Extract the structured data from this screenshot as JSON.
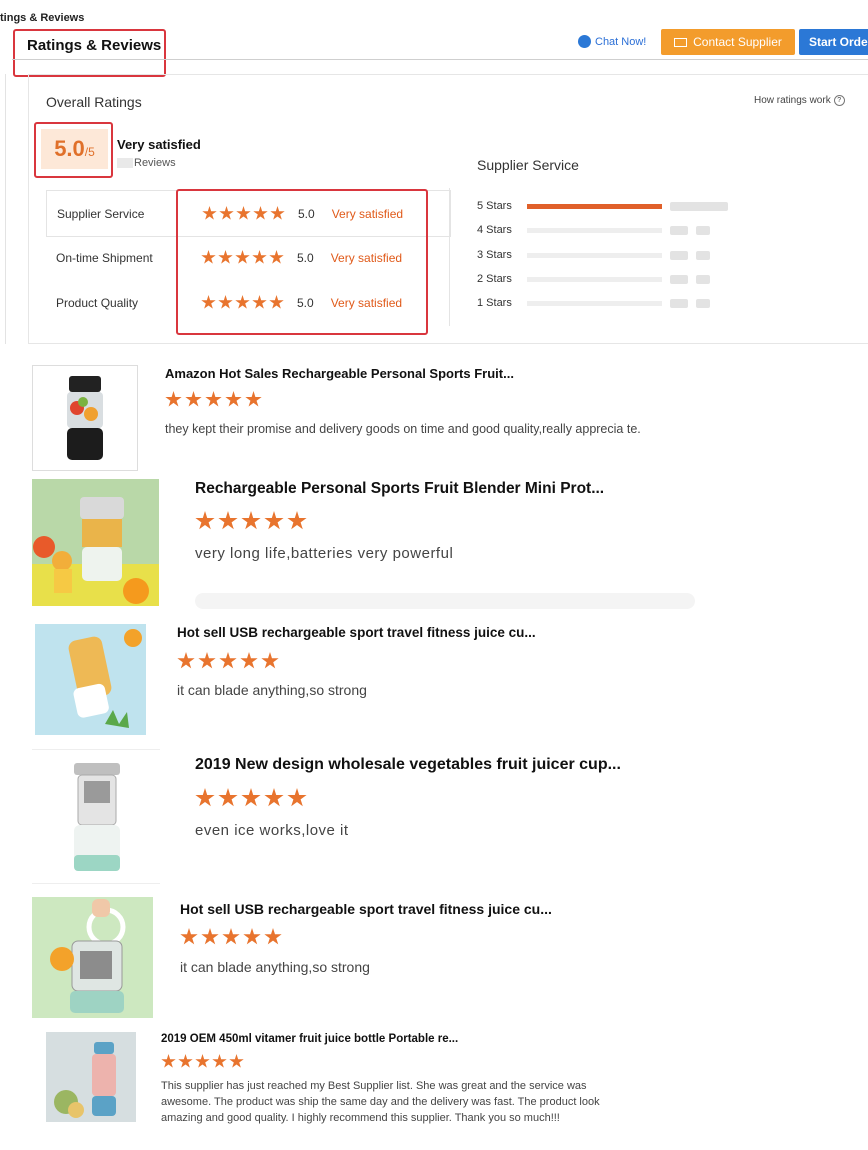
{
  "breadcrumb": "tings & Reviews",
  "tab": {
    "title": "Ratings & Reviews"
  },
  "actions": {
    "chat": "Chat Now!",
    "contact": "Contact Supplier",
    "start_order": "Start Order"
  },
  "overall": {
    "heading": "Overall Ratings",
    "how_ratings_work": "How ratings work",
    "score": "5.0",
    "score_max": "/5",
    "satisfaction": "Very satisfied",
    "reviews_label": "Reviews"
  },
  "ratings": [
    {
      "label": "Supplier Service",
      "stars": 5,
      "value": "5.0",
      "text": "Very satisfied"
    },
    {
      "label": "On-time Shipment",
      "stars": 5,
      "value": "5.0",
      "text": "Very satisfied"
    },
    {
      "label": "Product Quality",
      "stars": 5,
      "value": "5.0",
      "text": "Very satisfied"
    }
  ],
  "supplier_service": {
    "title": "Supplier Service",
    "bars": [
      {
        "label": "5 Stars",
        "fraction": 1.0
      },
      {
        "label": "4 Stars",
        "fraction": 0
      },
      {
        "label": "3 Stars",
        "fraction": 0
      },
      {
        "label": "2 Stars",
        "fraction": 0
      },
      {
        "label": "1 Stars",
        "fraction": 0
      }
    ]
  },
  "reviews": [
    {
      "title": "Amazon Hot Sales Rechargeable Personal Sports Fruit...",
      "stars": 5,
      "text": "they kept their promise and delivery goods on time and good quality,really apprecia te."
    },
    {
      "title": "Rechargeable Personal Sports Fruit Blender Mini Prot...",
      "stars": 5,
      "text": "very long life,batteries very powerful"
    },
    {
      "title": "Hot sell USB rechargeable sport travel fitness juice cu...",
      "stars": 5,
      "text": "it can blade anything,so strong"
    },
    {
      "title": "2019 New design wholesale vegetables fruit juicer cup...",
      "stars": 5,
      "text": "even ice works,love it"
    },
    {
      "title": "Hot sell USB rechargeable sport travel fitness juice cu...",
      "stars": 5,
      "text": "it can blade anything,so strong"
    },
    {
      "title": "2019 OEM 450ml vitamer fruit juice bottle Portable re...",
      "stars": 5,
      "text": "This supplier has just reached my Best Supplier list. She was great and the service was awesome. The product was ship the same day and the delivery was fast. The product look amazing and good quality. I highly recommend this supplier. Thank you so much!!!"
    }
  ],
  "colors": {
    "star": "#e8742e",
    "accent_orange": "#f39c2c",
    "accent_blue": "#2b78d6",
    "highlight_red": "#d9363e"
  }
}
